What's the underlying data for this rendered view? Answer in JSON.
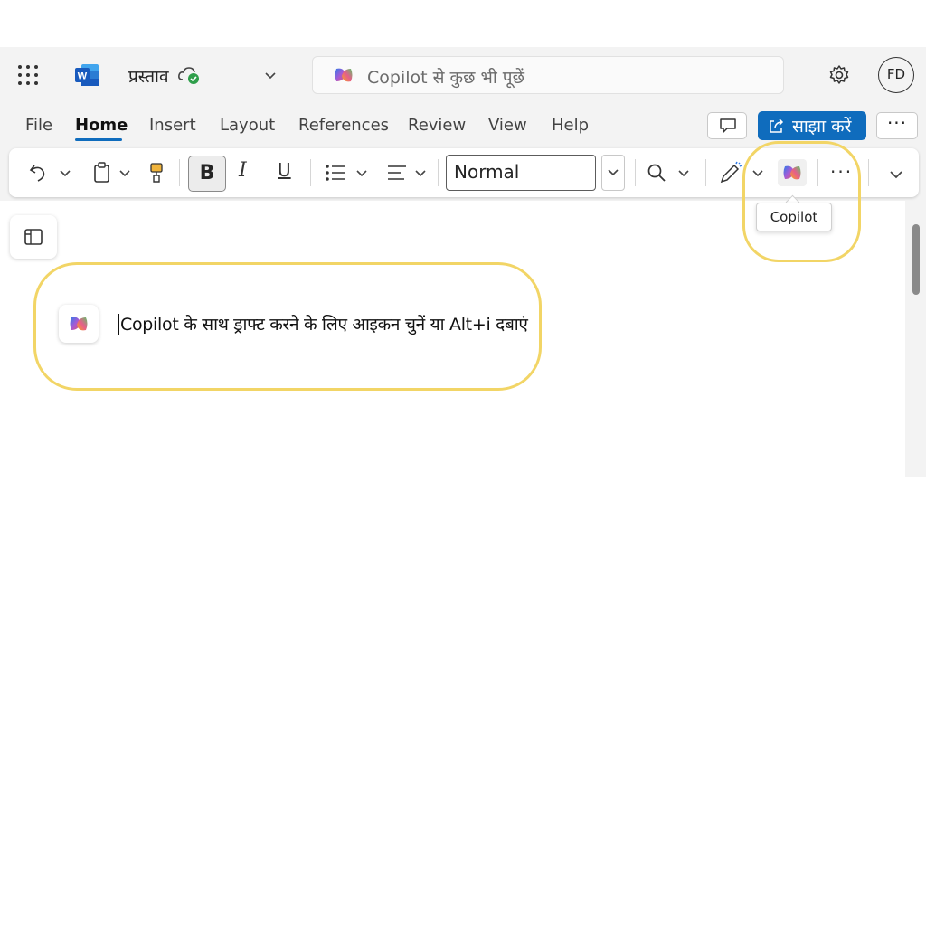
{
  "titlebar": {
    "doc_title": "प्रस्ताव",
    "search_placeholder": "Copilot से कुछ भी पूछें",
    "avatar_initials": "FD"
  },
  "menu": {
    "tabs": [
      "File",
      "Home",
      "Insert",
      "Layout",
      "References",
      "Review",
      "View",
      "Help"
    ],
    "active_tab": "Home",
    "share_label": "साझा करें",
    "more_label": "···"
  },
  "ribbon": {
    "bold_label": "B",
    "italic_label": "I",
    "underline_label": "U",
    "style_value": "Normal",
    "more_label": "···",
    "copilot_tooltip": "Copilot"
  },
  "document": {
    "copilot_hint": "Copilot के साथ ड्राफ्ट करने के लिए आइकन चुनें या Alt+i दबाएं"
  },
  "colors": {
    "accent": "#0f6cbd",
    "highlight": "#f2d566",
    "word_blue": "#185abd"
  }
}
